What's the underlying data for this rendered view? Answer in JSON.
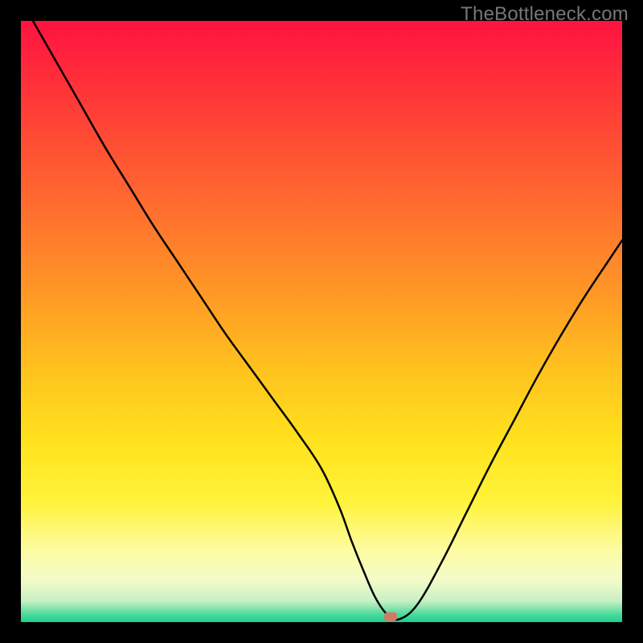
{
  "watermark": {
    "text": "TheBottleneck.com"
  },
  "chart_data": {
    "type": "line",
    "title": "",
    "xlabel": "",
    "ylabel": "",
    "xlim": [
      0,
      100
    ],
    "ylim": [
      0,
      100
    ],
    "grid": false,
    "legend": false,
    "background": {
      "type": "vertical-gradient",
      "stops": [
        {
          "offset": 0.0,
          "color": "#ff1240"
        },
        {
          "offset": 0.14,
          "color": "#ff3b37"
        },
        {
          "offset": 0.3,
          "color": "#ff6a2f"
        },
        {
          "offset": 0.45,
          "color": "#ff9726"
        },
        {
          "offset": 0.58,
          "color": "#ffc21e"
        },
        {
          "offset": 0.7,
          "color": "#ffe21d"
        },
        {
          "offset": 0.8,
          "color": "#fff33a"
        },
        {
          "offset": 0.88,
          "color": "#fdfca2"
        },
        {
          "offset": 0.93,
          "color": "#f3fbc9"
        },
        {
          "offset": 0.965,
          "color": "#c8f0c3"
        },
        {
          "offset": 0.985,
          "color": "#57dca0"
        },
        {
          "offset": 1.0,
          "color": "#18d18b"
        }
      ]
    },
    "series": [
      {
        "name": "bottleneck-curve",
        "color": "#000000",
        "stroke_width": 2.5,
        "x": [
          2,
          6,
          10,
          14,
          18,
          22,
          26,
          30,
          34,
          38,
          42,
          46,
          50,
          53,
          55,
          57,
          59,
          61,
          63,
          66,
          70,
          74,
          78,
          82,
          86,
          90,
          94,
          98,
          100
        ],
        "y": [
          100,
          93,
          86,
          79,
          72.5,
          66,
          60,
          54,
          48,
          42.5,
          37,
          31.5,
          25.5,
          19,
          13.5,
          8.5,
          4,
          1.2,
          0.5,
          3,
          10,
          18,
          26,
          33.5,
          41,
          48,
          54.5,
          60.5,
          63.5
        ]
      }
    ],
    "annotations": [
      {
        "name": "minimum-marker",
        "shape": "rounded-rect",
        "x": 61.5,
        "y": 0.9,
        "width_pct": 2.2,
        "height_pct": 1.5,
        "fill": "#d07a66"
      }
    ]
  }
}
